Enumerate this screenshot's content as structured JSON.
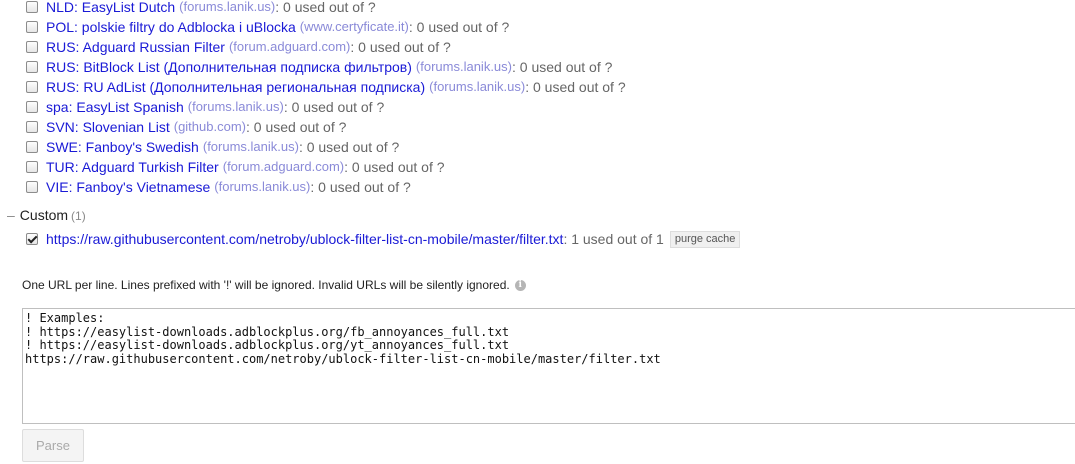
{
  "filter_lists": [
    {
      "name": "NLD: EasyList Dutch",
      "support": "(forums.lanik.us)",
      "usage": ": 0 used out of ?",
      "checked": false
    },
    {
      "name": "POL: polskie filtry do Adblocka i uBlocka",
      "support": "(www.certyficate.it)",
      "usage": ": 0 used out of ?",
      "checked": false
    },
    {
      "name": "RUS: Adguard Russian Filter",
      "support": "(forum.adguard.com)",
      "usage": ": 0 used out of ?",
      "checked": false
    },
    {
      "name": "RUS: BitBlock List (Дополнительная подписка фильтров)",
      "support": "(forums.lanik.us)",
      "usage": ": 0 used out of ?",
      "checked": false
    },
    {
      "name": "RUS: RU AdList (Дополнительная региональная подписка)",
      "support": "(forums.lanik.us)",
      "usage": ": 0 used out of ?",
      "checked": false
    },
    {
      "name": "spa: EasyList Spanish",
      "support": "(forums.lanik.us)",
      "usage": ": 0 used out of ?",
      "checked": false
    },
    {
      "name": "SVN: Slovenian List",
      "support": "(github.com)",
      "usage": ": 0 used out of ?",
      "checked": false
    },
    {
      "name": "SWE: Fanboy's Swedish",
      "support": "(forums.lanik.us)",
      "usage": ": 0 used out of ?",
      "checked": false
    },
    {
      "name": "TUR: Adguard Turkish Filter",
      "support": "(forum.adguard.com)",
      "usage": ": 0 used out of ?",
      "checked": false
    },
    {
      "name": "VIE: Fanboy's Vietnamese",
      "support": "(forums.lanik.us)",
      "usage": ": 0 used out of ?",
      "checked": false
    }
  ],
  "custom": {
    "toggle": "–",
    "title": "Custom",
    "count": "(1)",
    "items": [
      {
        "name": "https://raw.githubusercontent.com/netroby/ublock-filter-list-cn-mobile/master/filter.txt",
        "usage": " : 1 used out of 1",
        "checked": true,
        "purge_label": "purge cache"
      }
    ]
  },
  "hint": {
    "text": "One URL per line. Lines prefixed with '!' will be ignored. Invalid URLs will be silently ignored.",
    "icon": "info-icon",
    "icon_glyph": "i"
  },
  "textarea": {
    "value": "! Examples:\n! https://easylist-downloads.adblockplus.org/fb_annoyances_full.txt\n! https://easylist-downloads.adblockplus.org/yt_annoyances_full.txt\nhttps://raw.githubusercontent.com/netroby/ublock-filter-list-cn-mobile/master/filter.txt"
  },
  "parse_button": {
    "label": "Parse",
    "disabled": true
  },
  "colors": {
    "link": "#1a1ad6",
    "support_link": "#8a8ad8",
    "muted": "#666666"
  }
}
